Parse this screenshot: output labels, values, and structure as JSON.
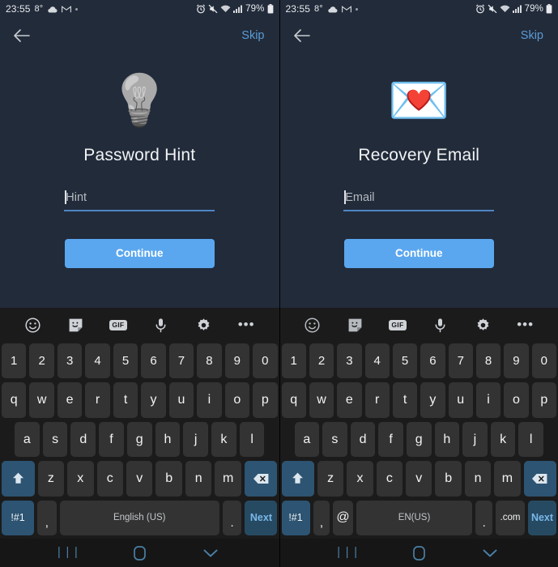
{
  "statusbar": {
    "time": "23:55",
    "temperature": "8°",
    "icons_left": [
      "cloud-icon",
      "gmail-icon",
      "dot-indicator"
    ],
    "icons_right": [
      "alarm-icon",
      "mute-icon",
      "wifi-icon",
      "signal-icon"
    ],
    "battery_percent": "79%"
  },
  "screens": [
    {
      "id": "password-hint",
      "appbar": {
        "back_label": "back",
        "skip_label": "Skip"
      },
      "hero_emoji": "💡",
      "hero_emoji_name": "light-bulb-emoji",
      "title": "Password Hint",
      "field": {
        "placeholder": "Hint",
        "value": ""
      },
      "button_label": "Continue",
      "keyboard": {
        "toolbar": [
          "emoji-icon",
          "sticker-icon",
          "gif-icon",
          "microphone-icon",
          "settings-gear-icon",
          "more-options-icon"
        ],
        "gif_label": "GIF",
        "row_numbers": [
          "1",
          "2",
          "3",
          "4",
          "5",
          "6",
          "7",
          "8",
          "9",
          "0"
        ],
        "row_top": [
          "q",
          "w",
          "e",
          "r",
          "t",
          "y",
          "u",
          "i",
          "o",
          "p"
        ],
        "row_home": [
          "a",
          "s",
          "d",
          "f",
          "g",
          "h",
          "j",
          "k",
          "l"
        ],
        "row_bottom": [
          "z",
          "x",
          "c",
          "v",
          "b",
          "n",
          "m"
        ],
        "shift_label": "⬆",
        "backspace_label": "⌫",
        "symbols_label": "!#1",
        "comma_label": ",",
        "space_label": "English (US)",
        "period_label": ".",
        "enter_label": "Next",
        "has_at_key": false,
        "has_dotcom_key": false
      }
    },
    {
      "id": "recovery-email",
      "appbar": {
        "back_label": "back",
        "skip_label": "Skip"
      },
      "hero_emoji": "💌",
      "hero_emoji_name": "love-letter-emoji",
      "title": "Recovery Email",
      "field": {
        "placeholder": "Email",
        "value": ""
      },
      "button_label": "Continue",
      "keyboard": {
        "toolbar": [
          "emoji-icon",
          "sticker-icon",
          "gif-icon",
          "microphone-icon",
          "settings-gear-icon",
          "more-options-icon"
        ],
        "gif_label": "GIF",
        "row_numbers": [
          "1",
          "2",
          "3",
          "4",
          "5",
          "6",
          "7",
          "8",
          "9",
          "0"
        ],
        "row_top": [
          "q",
          "w",
          "e",
          "r",
          "t",
          "y",
          "u",
          "i",
          "o",
          "p"
        ],
        "row_home": [
          "a",
          "s",
          "d",
          "f",
          "g",
          "h",
          "j",
          "k",
          "l"
        ],
        "row_bottom": [
          "z",
          "x",
          "c",
          "v",
          "b",
          "n",
          "m"
        ],
        "shift_label": "⬆",
        "backspace_label": "⌫",
        "symbols_label": "!#1",
        "comma_label": ",",
        "at_label": "@",
        "space_label": "EN(US)",
        "period_label": ".",
        "dotcom_label": ".com",
        "enter_label": "Next",
        "has_at_key": true,
        "has_dotcom_key": true
      }
    }
  ],
  "navbar": {
    "recents_label": "recents-icon",
    "home_label": "home-icon",
    "dismiss_label": "dismiss-keyboard-icon"
  },
  "colors": {
    "app_background": "#222b3a",
    "keyboard_background": "#1b1b1b",
    "key": "#333333",
    "accent_key": "#2d5472",
    "enter_key": "#274a63",
    "primary_button": "#5aa7ef",
    "link": "#5b9bd5",
    "field_underline": "#4e86c4",
    "navbar": "#161616"
  }
}
